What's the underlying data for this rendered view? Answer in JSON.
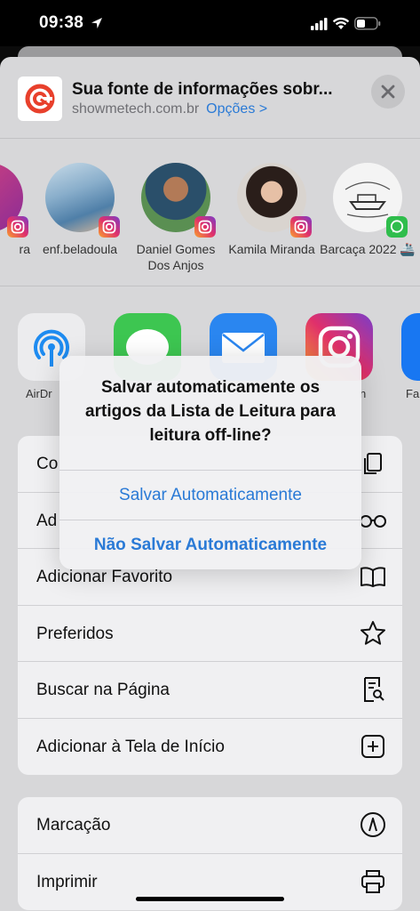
{
  "status": {
    "time": "09:38"
  },
  "header": {
    "title": "Sua fonte de informações sobr...",
    "domain": "showmetech.com.br",
    "options_label": "Opções >"
  },
  "people": [
    {
      "name": "ra",
      "badge": "instagram"
    },
    {
      "name": "enf.beladoula",
      "badge": "instagram"
    },
    {
      "name": "Daniel Gomes Dos Anjos",
      "badge": "instagram"
    },
    {
      "name": "Kamila Miranda",
      "badge": "instagram"
    },
    {
      "name": "Barcaça 2022 🚢",
      "badge": "whatsapp"
    }
  ],
  "apps": [
    {
      "name": "airdrop",
      "label": "AirDr"
    },
    {
      "name": "messages",
      "label": ""
    },
    {
      "name": "mail",
      "label": ""
    },
    {
      "name": "instagram",
      "label": "n"
    },
    {
      "name": "facebook",
      "label": "Fa"
    }
  ],
  "actions_group1": [
    {
      "label": "Co",
      "icon": "copy-icon"
    },
    {
      "label": "Ad",
      "icon": "glasses-icon"
    },
    {
      "label": "Adicionar Favorito",
      "icon": "book-icon"
    },
    {
      "label": "Preferidos",
      "icon": "star-icon"
    },
    {
      "label": "Buscar na Página",
      "icon": "find-in-page-icon"
    },
    {
      "label": "Adicionar à Tela de Início",
      "icon": "add-square-icon"
    }
  ],
  "actions_group2": [
    {
      "label": "Marcação",
      "icon": "markup-icon"
    },
    {
      "label": "Imprimir",
      "icon": "printer-icon"
    }
  ],
  "alert": {
    "message": "Salvar automaticamente os artigos da Lista de Leitura para leitura off-line?",
    "button_auto": "Salvar Automaticamente",
    "button_no": "Não Salvar Automaticamente"
  },
  "colors": {
    "accent": "#2a7ad6",
    "sheet": "#d7d7d9",
    "card": "#f0f0f2"
  }
}
